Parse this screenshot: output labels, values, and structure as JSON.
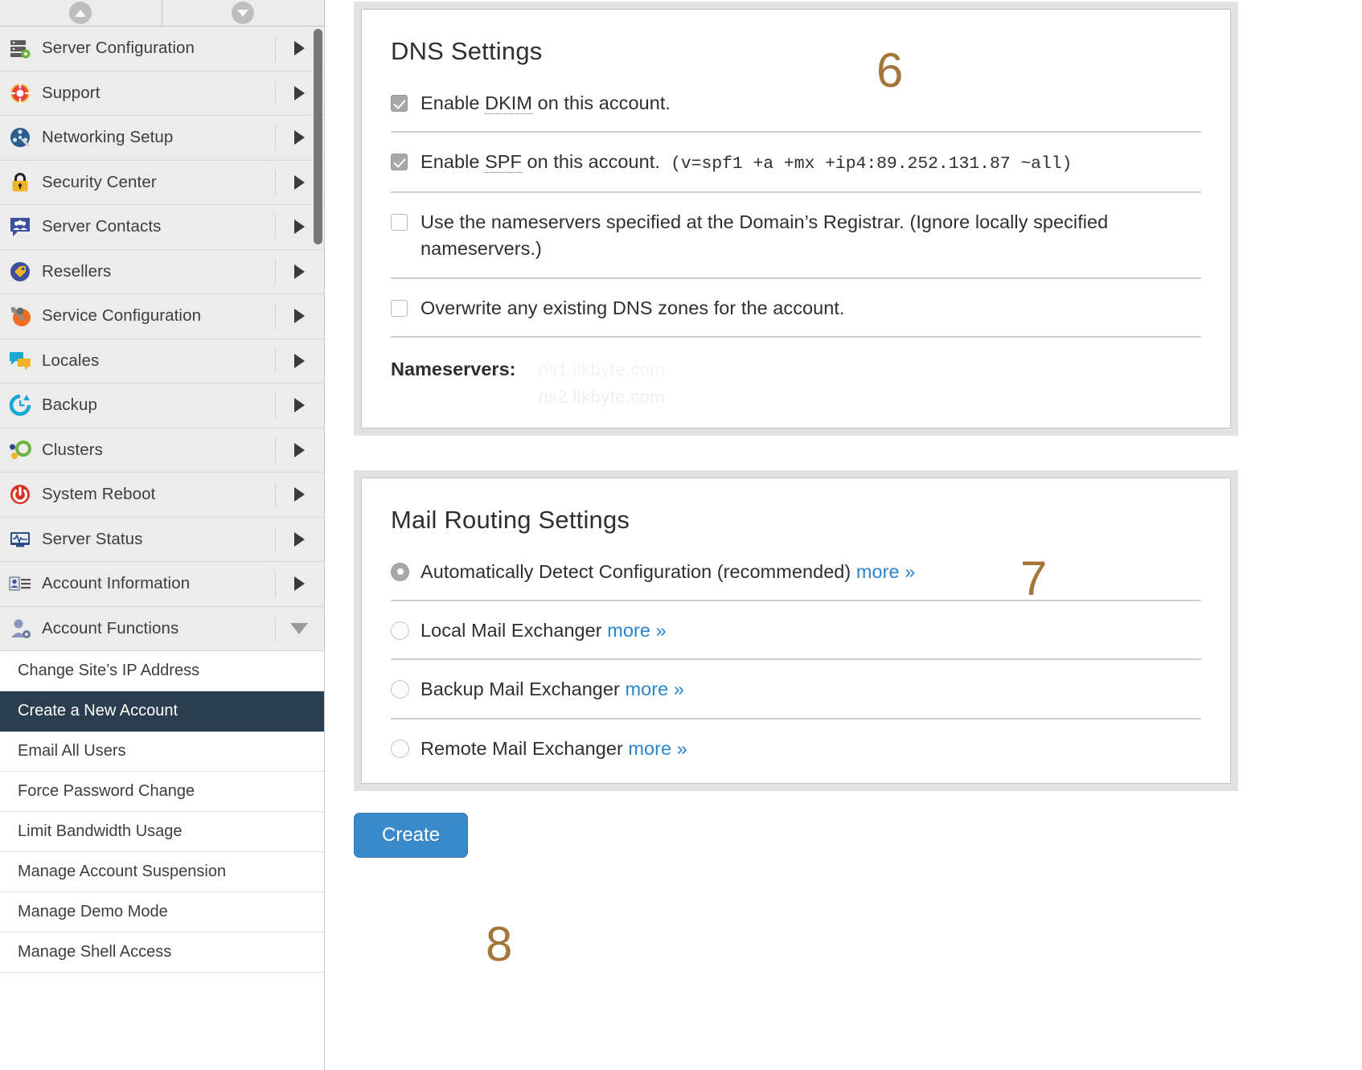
{
  "sidebar": {
    "scroll_up_icon": "circle-up-arrow-icon",
    "scroll_down_icon": "circle-down-arrow-icon",
    "nav_items": [
      {
        "label": "Server Configuration",
        "icon": "server-gear-icon",
        "expander": "right"
      },
      {
        "label": "Support",
        "icon": "lifebuoy-icon",
        "expander": "right"
      },
      {
        "label": "Networking Setup",
        "icon": "network-wrench-icon",
        "expander": "right"
      },
      {
        "label": "Security Center",
        "icon": "padlock-icon",
        "expander": "right"
      },
      {
        "label": "Server Contacts",
        "icon": "contacts-speech-bubble-icon",
        "expander": "right"
      },
      {
        "label": "Resellers",
        "icon": "price-tag-icon",
        "expander": "right"
      },
      {
        "label": "Service Configuration",
        "icon": "wrench-gear-icon",
        "expander": "right"
      },
      {
        "label": "Locales",
        "icon": "locales-speech-bubble-icon",
        "expander": "right"
      },
      {
        "label": "Backup",
        "icon": "backup-clock-icon",
        "expander": "right"
      },
      {
        "label": "Clusters",
        "icon": "clusters-nodes-icon",
        "expander": "right"
      },
      {
        "label": "System Reboot",
        "icon": "power-icon",
        "expander": "right"
      },
      {
        "label": "Server Status",
        "icon": "monitor-pulse-icon",
        "expander": "right"
      },
      {
        "label": "Account Information",
        "icon": "id-card-icon",
        "expander": "right"
      },
      {
        "label": "Account Functions",
        "icon": "user-gear-icon",
        "expander": "down"
      }
    ],
    "sub_items": [
      {
        "label": "Change Site’s IP Address",
        "active": false
      },
      {
        "label": "Create a New Account",
        "active": true
      },
      {
        "label": "Email All Users",
        "active": false
      },
      {
        "label": "Force Password Change",
        "active": false
      },
      {
        "label": "Limit Bandwidth Usage",
        "active": false
      },
      {
        "label": "Manage Account Suspension",
        "active": false
      },
      {
        "label": "Manage Demo Mode",
        "active": false
      },
      {
        "label": "Manage Shell Access",
        "active": false
      }
    ]
  },
  "dns_panel": {
    "title": "DNS Settings",
    "annotation": "6",
    "dkim": {
      "checked": true,
      "text_before": "Enable ",
      "abbr": "DKIM",
      "text_after": " on this account."
    },
    "spf": {
      "checked": true,
      "text_before": "Enable ",
      "abbr": "SPF",
      "text_after": " on this account.",
      "record": "(v=spf1 +a +mx +ip4:89.252.131.87 ~all)"
    },
    "registrar_ns": {
      "checked": false,
      "text": "Use the nameservers specified at the Domain’s Registrar. (Ignore locally specified nameservers.)"
    },
    "overwrite_zones": {
      "checked": false,
      "text": "Overwrite any existing DNS zones for the account."
    },
    "nameservers": {
      "label": "Nameservers:",
      "values": [
        "ns1.ilkbyte.com",
        "ns2.ilkbyte.com"
      ]
    }
  },
  "mail_panel": {
    "title": "Mail Routing Settings",
    "annotation": "7",
    "options": [
      {
        "label": "Automatically Detect Configuration (recommended)",
        "more": "more »",
        "selected": true
      },
      {
        "label": "Local Mail Exchanger",
        "more": "more »",
        "selected": false
      },
      {
        "label": "Backup Mail Exchanger",
        "more": "more »",
        "selected": false
      },
      {
        "label": "Remote Mail Exchanger",
        "more": "more »",
        "selected": false
      }
    ]
  },
  "footer": {
    "create_label": "Create",
    "annotation": "8"
  },
  "colors": {
    "accent_blue": "#3a89c9",
    "link_blue": "#2a84cc",
    "annotation_brown": "#a5763a",
    "active_item_bg": "#2b3e50"
  }
}
